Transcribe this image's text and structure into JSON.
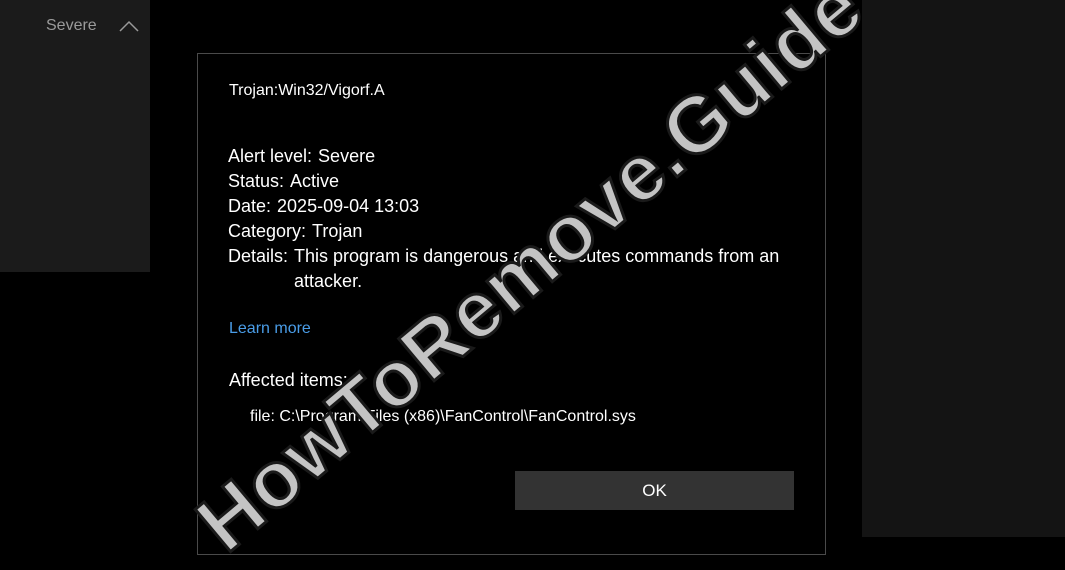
{
  "sidebar": {
    "severity_label": "Severe",
    "toggle_icon": "chevron-up-icon"
  },
  "dialog": {
    "threat_name": "Trojan:Win32/Vigorf.A",
    "alert_level_label": "Alert level:",
    "alert_level_value": "Severe",
    "status_label": "Status:",
    "status_value": "Active",
    "date_label": "Date:",
    "date_value": "2025-09-04 13:03",
    "category_label": "Category:",
    "category_value": "Trojan",
    "details_label": "Details:",
    "details_value": "This program is dangerous and executes commands from an attacker.",
    "learn_more": "Learn more",
    "affected_items_label": "Affected items:",
    "affected_item": "file: C:\\Program Files (x86)\\FanControl\\FanControl.sys",
    "ok_button": "OK"
  },
  "watermark": {
    "text": "HowToRemove.Guide"
  },
  "colors": {
    "background": "#000000",
    "side_panel": "#1b1b1b",
    "link": "#4a9de8",
    "button": "#333333",
    "watermark": "#c4c4c4"
  }
}
